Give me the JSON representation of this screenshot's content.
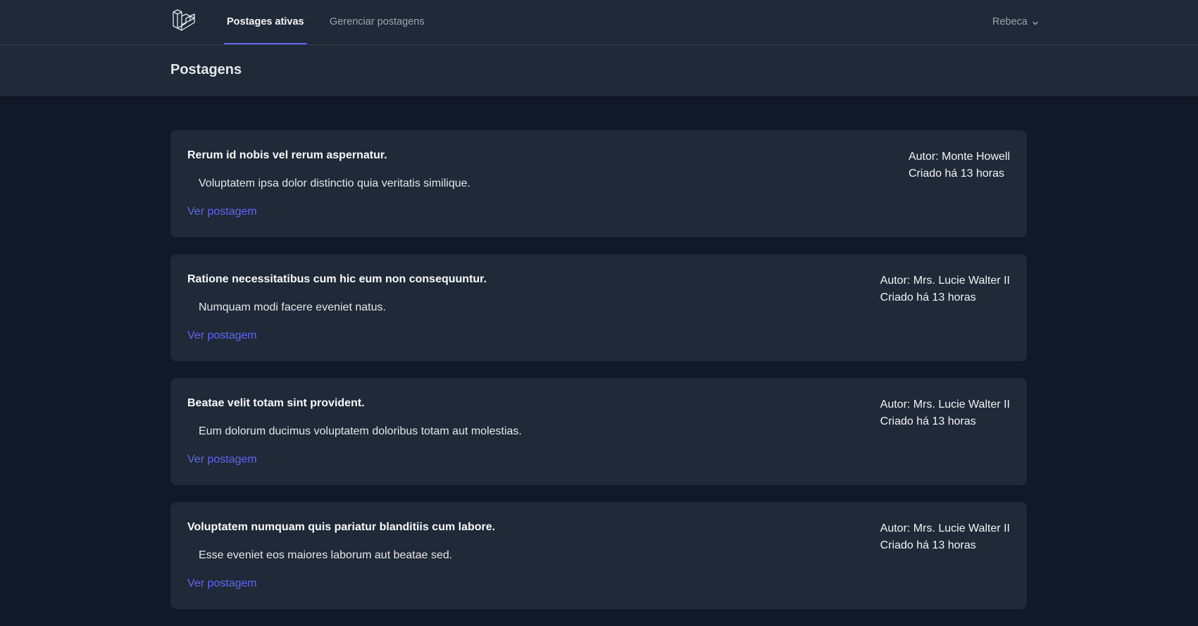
{
  "nav": {
    "logo_icon": "laravel-logo-icon",
    "links": [
      {
        "label": "Postages ativas",
        "active": true
      },
      {
        "label": "Gerenciar postagens",
        "active": false
      }
    ],
    "user": {
      "name": "Rebeca",
      "icon": "chevron-down-icon"
    }
  },
  "header": {
    "title": "Postagens"
  },
  "posts": [
    {
      "title": "Rerum id nobis vel rerum aspernatur.",
      "body": "Voluptatem ipsa dolor distinctio quia veritatis similique.",
      "link": "Ver postagem",
      "author": "Autor: Monte Howell",
      "created": "Criado há 13 horas"
    },
    {
      "title": "Ratione necessitatibus cum hic eum non consequuntur.",
      "body": "Numquam modi facere eveniet natus.",
      "link": "Ver postagem",
      "author": "Autor: Mrs. Lucie Walter II",
      "created": "Criado há 13 horas"
    },
    {
      "title": "Beatae velit totam sint provident.",
      "body": "Eum dolorum ducimus voluptatem doloribus totam aut molestias.",
      "link": "Ver postagem",
      "author": "Autor: Mrs. Lucie Walter II",
      "created": "Criado há 13 horas"
    },
    {
      "title": "Voluptatem numquam quis pariatur blanditiis cum labore.",
      "body": "Esse eveniet eos maiores laborum aut beatae sed.",
      "link": "Ver postagem",
      "author": "Autor: Mrs. Lucie Walter II",
      "created": "Criado há 13 horas"
    }
  ],
  "colors": {
    "background": "#111827",
    "surface": "#1f2937",
    "accent": "#6366f1",
    "muted_text": "#9ca3af"
  }
}
